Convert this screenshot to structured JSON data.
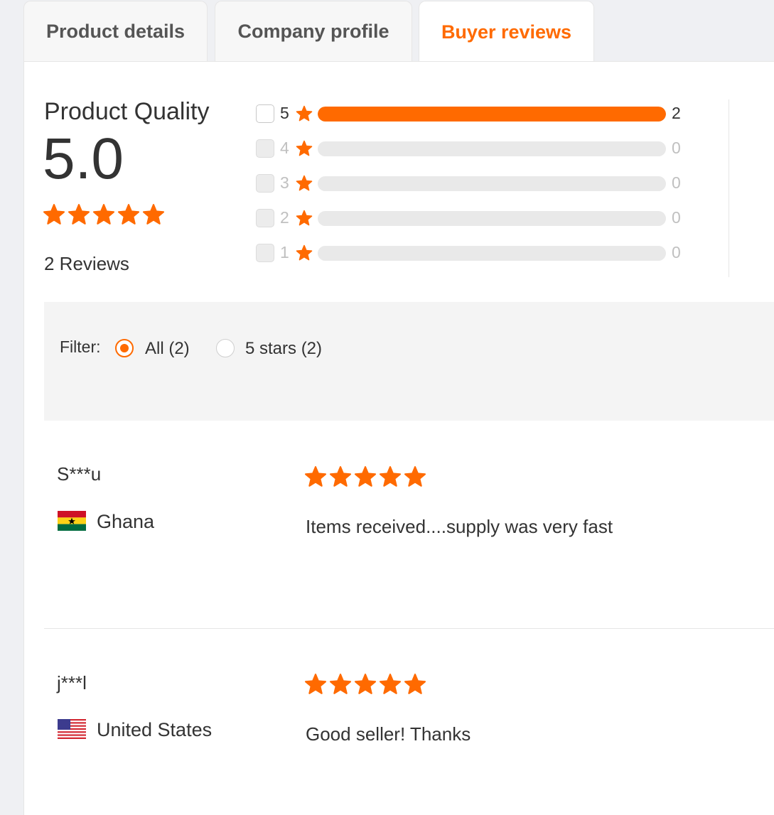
{
  "tabs": [
    {
      "label": "Product details",
      "active": false
    },
    {
      "label": "Company profile",
      "active": false
    },
    {
      "label": "Buyer reviews",
      "active": true
    }
  ],
  "summary": {
    "title": "Product Quality",
    "score": "5.0",
    "stars": 5,
    "reviews_label": "2 Reviews"
  },
  "breakdown": [
    {
      "stars": "5",
      "count": "2",
      "share": 1.0,
      "enabled": true
    },
    {
      "stars": "4",
      "count": "0",
      "share": 0,
      "enabled": false
    },
    {
      "stars": "3",
      "count": "0",
      "share": 0,
      "enabled": false
    },
    {
      "stars": "2",
      "count": "0",
      "share": 0,
      "enabled": false
    },
    {
      "stars": "1",
      "count": "0",
      "share": 0,
      "enabled": false
    }
  ],
  "filter": {
    "label": "Filter:",
    "options": [
      {
        "label": "All (2)",
        "selected": true
      },
      {
        "label": "5 stars (2)",
        "selected": false
      }
    ]
  },
  "reviews": [
    {
      "name": "S***u",
      "country": "Ghana",
      "flag": "ghana-flag-icon",
      "stars": 5,
      "text": "Items received....supply was very fast"
    },
    {
      "name": "j***l",
      "country": "United States",
      "flag": "usa-flag-icon",
      "stars": 5,
      "text": "Good seller! Thanks"
    }
  ],
  "colors": {
    "accent": "#ff6a00",
    "track": "#e9e9e9",
    "text": "#333333"
  },
  "icons": {
    "star": "star-icon"
  }
}
